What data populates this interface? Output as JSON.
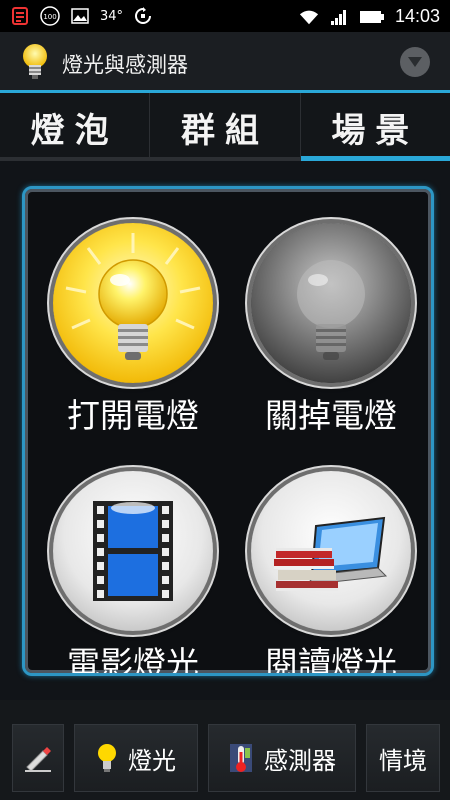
{
  "status_bar": {
    "battery_saver_badge": "100",
    "temperature": "34°",
    "time": "14:03"
  },
  "app_bar": {
    "title": "燈光與感測器"
  },
  "tabs": [
    {
      "label": "燈泡",
      "active": false
    },
    {
      "label": "群組",
      "active": false
    },
    {
      "label": "場景",
      "active": true
    }
  ],
  "scenes": [
    {
      "label": "打開電燈",
      "icon": "lit-bulb-icon"
    },
    {
      "label": "關掉電燈",
      "icon": "unlit-bulb-icon"
    },
    {
      "label": "電影燈光",
      "icon": "film-strip-icon"
    },
    {
      "label": "閱讀燈光",
      "icon": "books-laptop-icon"
    }
  ],
  "bottom_nav": {
    "lights_label": "燈光",
    "sensors_label": "感測器",
    "scenes_label": "情境"
  },
  "colors": {
    "accent": "#2aa8d8"
  }
}
